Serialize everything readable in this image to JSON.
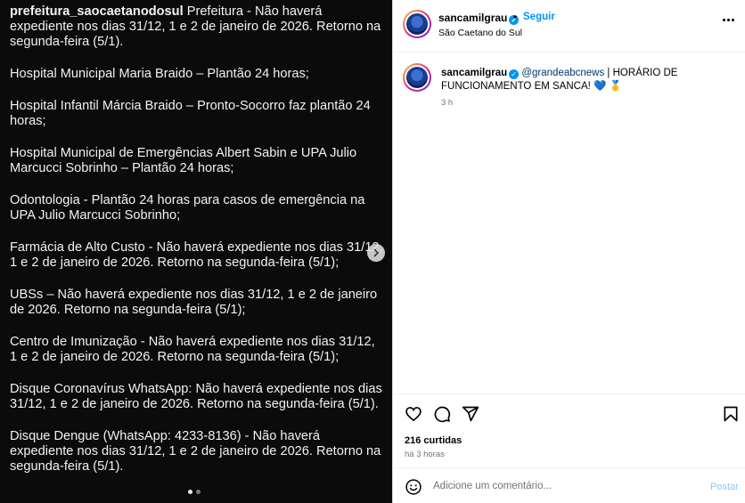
{
  "slide": {
    "author": "prefeitura_saocaetanodosul",
    "paragraphs": [
      "Prefeitura - Não haverá expediente nos dias 31/12, 1 e 2 de janeiro de 2026. Retorno na segunda-feira (5/1).",
      "Hospital Municipal Maria Braido – Plantão 24 horas;",
      "Hospital Infantil Márcia Braido – Pronto-Socorro faz plantão 24 horas;",
      "Hospital Municipal de Emergências Albert Sabin e UPA Julio Marcucci Sobrinho – Plantão 24 horas;",
      "Odontologia - Plantão 24 horas para casos de emergência na UPA Julio Marcucci Sobrinho;",
      "Farmácia de Alto Custo -  Não haverá expediente nos dias 31/12, 1 e 2 de janeiro de 2026. Retorno na segunda-feira (5/1);",
      "UBSs – Não haverá expediente nos dias 31/12, 1 e 2 de janeiro de 2026. Retorno na segunda-feira (5/1);",
      "Centro de Imunização - Não haverá expediente nos dias 31/12, 1 e 2 de janeiro de 2026. Retorno na segunda-feira (5/1);",
      "Disque Coronavírus WhatsApp: Não haverá expediente nos dias 31/12, 1 e 2 de janeiro de 2026. Retorno na segunda-feira (5/1).",
      "Disque Dengue (WhatsApp: 4233-8136) - Não haverá expediente nos dias 31/12, 1 e 2 de janeiro de 2026. Retorno na segunda-feira (5/1)."
    ],
    "next_icon": "chevron-right-icon",
    "dots_total": 2,
    "dots_active": 1
  },
  "header": {
    "username": "sancamilgrau",
    "verified_icon": "verified-badge-icon",
    "separator": "•",
    "follow_label": "Seguir",
    "location": "São Caetano do Sul",
    "more_icon": "more-options-icon"
  },
  "caption": {
    "username": "sancamilgrau",
    "mention": "@grandeabcnews",
    "text": " | HORÁRIO DE FUNCIONAMENTO EM SANCA! ",
    "emoji_heart": "💙",
    "emoji_medal": "🥇",
    "time": "3 h"
  },
  "actions": {
    "like_icon": "heart-icon",
    "comment_icon": "comment-icon",
    "share_icon": "share-icon",
    "save_icon": "bookmark-icon"
  },
  "stats": {
    "likes": "216 curtidas",
    "ago": "há 3 horas"
  },
  "comment": {
    "placeholder": "Adicione um comentário...",
    "post_label": "Postar",
    "emoji_icon": "smiley-icon"
  },
  "colors": {
    "accent": "#0095f6",
    "post_disabled": "#8fc8f5",
    "muted": "#737373",
    "slide_bg": "#0b0b0b"
  }
}
